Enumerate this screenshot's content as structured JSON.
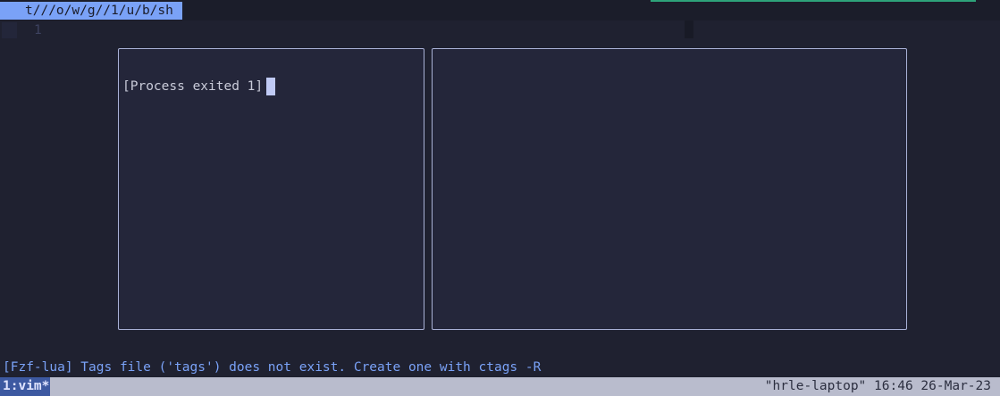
{
  "tabline": {
    "active_tab": "t///o/w/g//1/u/b/sh"
  },
  "editor": {
    "line_number": "1"
  },
  "terminal": {
    "process_text": "[Process exited 1]"
  },
  "message_line": "[Fzf-lua] Tags file ('tags') does not exist. Create one with ctags -R",
  "status_bar": {
    "window": "1:vim*",
    "hostname": "\"hrle-laptop\"",
    "time": "16:46",
    "date": "26-Mar-23"
  },
  "colors": {
    "background": "#1f2130",
    "accent_blue": "#7aa2f7",
    "status_bar": "#b9bccd",
    "window_tab": "#3d59a1",
    "tab_accent_green": "#2ea37a"
  }
}
